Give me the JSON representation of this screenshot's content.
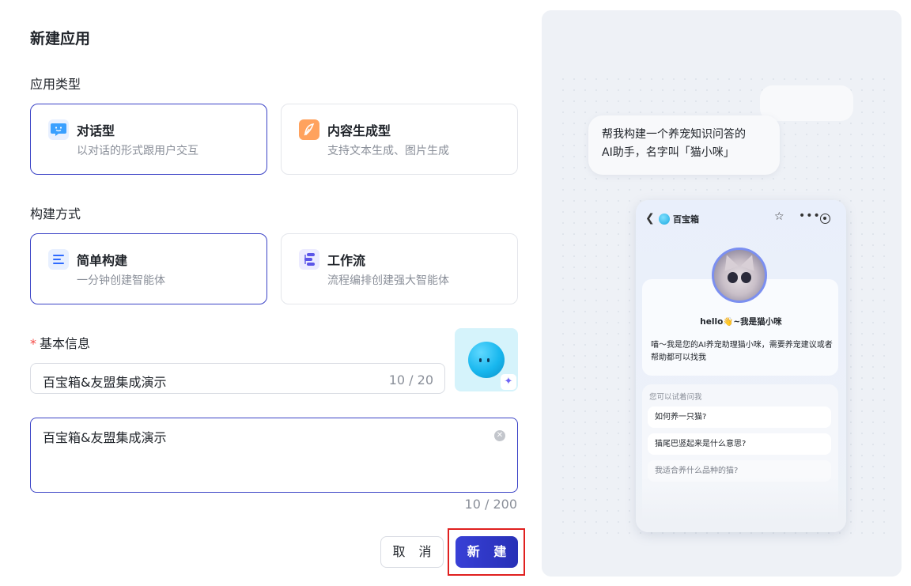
{
  "dialog": {
    "title": "新建应用",
    "app_type_label": "应用类型",
    "build_method_label": "构建方式",
    "basic_info_label": "基本信息",
    "required_mark": "*"
  },
  "app_types": [
    {
      "title": "对话型",
      "desc": "以对话的形式跟用户交互",
      "icon": "chat-icon",
      "selected": true
    },
    {
      "title": "内容生成型",
      "desc": "支持文本生成、图片生成",
      "icon": "feather-icon",
      "selected": false
    }
  ],
  "build_methods": [
    {
      "title": "简单构建",
      "desc": "一分钟创建智能体",
      "icon": "list-icon",
      "selected": true
    },
    {
      "title": "工作流",
      "desc": "流程编排创建强大智能体",
      "icon": "workflow-icon",
      "selected": false
    }
  ],
  "name_input": {
    "value": "百宝箱&友盟集成演示",
    "counter": "10 / 20"
  },
  "desc_input": {
    "value": "百宝箱&友盟集成演示",
    "counter": "10 / 200"
  },
  "buttons": {
    "cancel": "取 消",
    "create": "新 建"
  },
  "colors": {
    "accent": "#3b43c6",
    "highlight": "#e0201f"
  },
  "preview": {
    "prompt_bubble_line1": "帮我构建一个养宠知识问答的",
    "prompt_bubble_line2": "AI助手，名字叫「猫小咪」",
    "phone_title": "百宝箱",
    "greeting": "hello👋~我是猫小咪",
    "intro": "喵～我是您的AI养宠助理猫小咪，需要养宠建议或者帮助都可以找我",
    "try_label": "您可以试着问我",
    "questions": [
      "如何养一只猫?",
      "猫尾巴竖起来是什么意思?",
      "我适合养什么品种的猫?"
    ]
  }
}
